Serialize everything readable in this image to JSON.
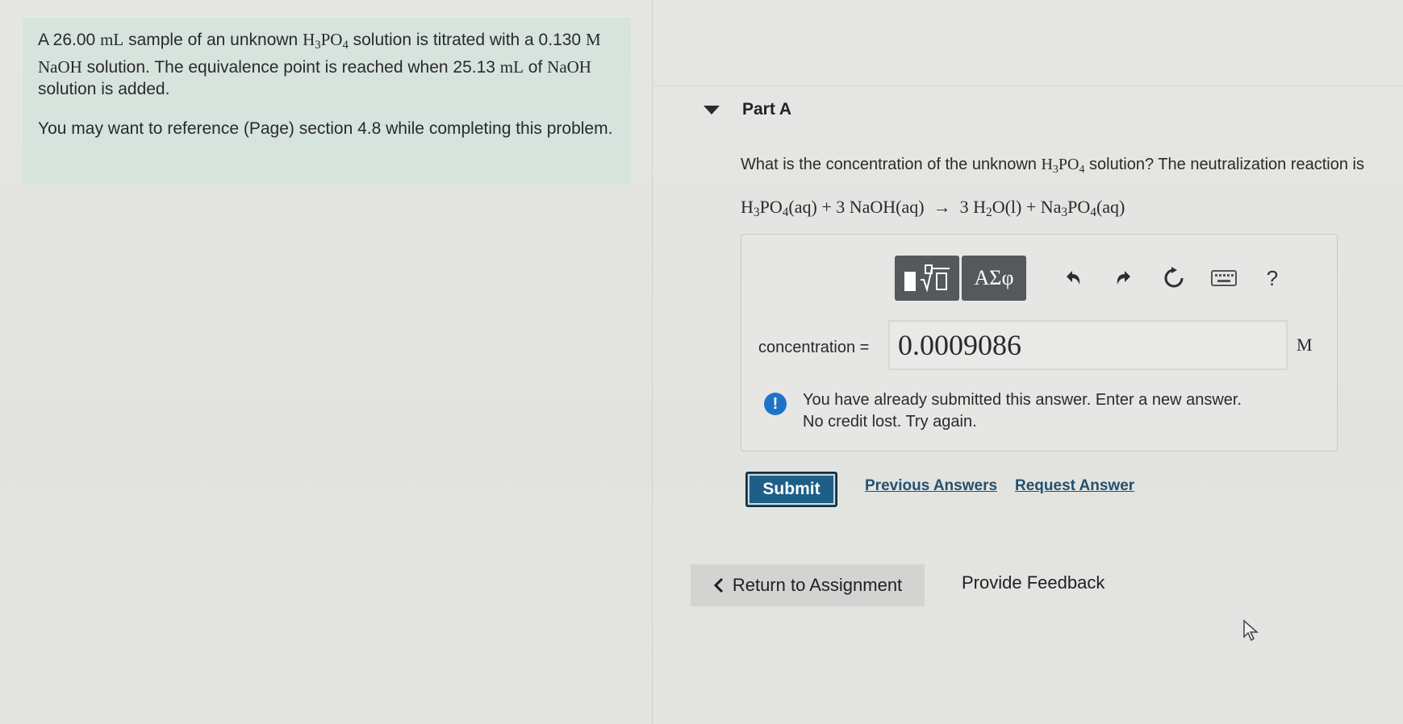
{
  "problem": {
    "intro_a": "A 26.00 ",
    "intro_unit_ml": "mL",
    "intro_b": " sample of an unknown ",
    "h3po4_h": "H",
    "h3po4_3": "3",
    "h3po4_po": "PO",
    "h3po4_4": "4",
    "intro_c": " solution is titrated with a 0.130 ",
    "molar_m": "M",
    "naoh": "NaOH",
    "intro_d": " solution. The equivalence point is reached when 25.13 ",
    "intro_unit_ml2": "mL",
    "intro_e": " of ",
    "naoh2": "NaOH",
    "intro_f": " solution is added.",
    "reference": "You may want to reference (Page) section 4.8 while completing this problem."
  },
  "part": {
    "title": "Part A",
    "question_a": "What is the concentration of the unknown ",
    "question_b": " solution? The neutralization reaction is",
    "equation_lhs": "PO",
    "equation_aq1": "(aq) + 3 NaOH(aq)",
    "arrow": "→",
    "equation_mid": "3 H",
    "equation_2": "2",
    "equation_o": "O(l) + Na",
    "equation_3": "3",
    "equation_po": "PO",
    "equation_4": "4",
    "equation_end": "(aq)"
  },
  "toolbar": {
    "greek": "ΑΣφ",
    "help": "?"
  },
  "answer": {
    "label": "concentration =",
    "value": "0.0009086",
    "unit": "M"
  },
  "feedback": {
    "icon": "!",
    "line1": "You have already submitted this answer. Enter a new answer.",
    "line2": "No credit lost. Try again."
  },
  "actions": {
    "submit": "Submit",
    "previous_answers": "Previous Answers",
    "request_answer": "Request Answer",
    "return_to_assignment": "Return to Assignment",
    "provide_feedback": "Provide Feedback"
  }
}
